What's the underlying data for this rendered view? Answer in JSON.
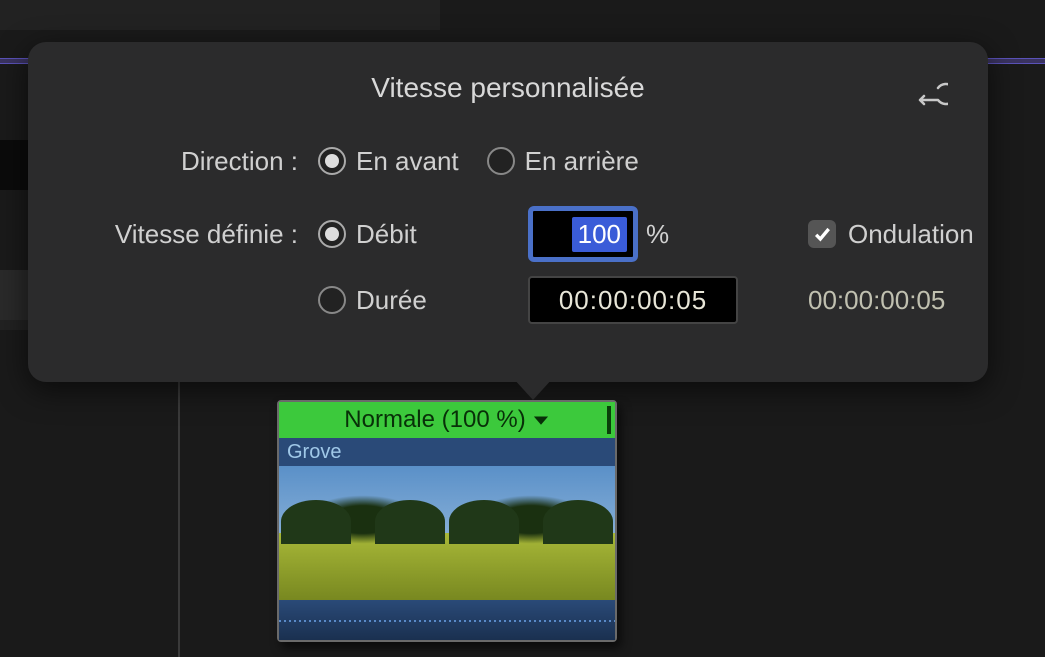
{
  "popover": {
    "title": "Vitesse personnalisée",
    "direction": {
      "label": "Direction :",
      "forward": "En avant",
      "reverse": "En arrière",
      "selected": "forward"
    },
    "setSpeed": {
      "label": "Vitesse définie :",
      "rate": "Débit",
      "duration": "Durée",
      "selected": "rate",
      "rateValue": "100",
      "ratePercent": "%",
      "durationValue": "00:00:00:05",
      "durationDisplay": "00:00:00:05"
    },
    "ripple": {
      "label": "Ondulation",
      "checked": true
    }
  },
  "clip": {
    "speedLabel": "Normale (100 %)",
    "name": "Grove"
  }
}
